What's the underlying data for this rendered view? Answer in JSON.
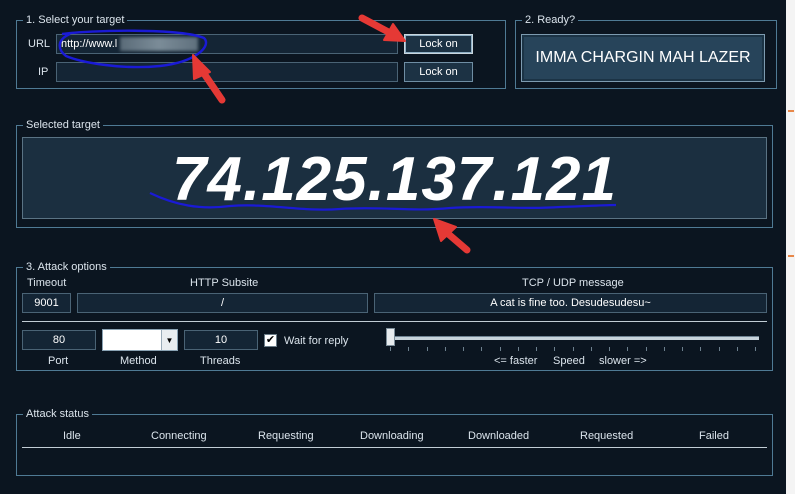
{
  "target": {
    "legend": "1. Select your target",
    "url_label": "URL",
    "url_value": "http://www.l",
    "ip_label": "IP",
    "ip_value": "",
    "lock_on_label": "Lock on",
    "lock_on_ip_label": "Lock on"
  },
  "ready": {
    "legend": "2. Ready?",
    "button_label": "IMMA CHARGIN MAH LAZER"
  },
  "selected": {
    "legend": "Selected target",
    "ip": "74.125.137.121"
  },
  "attack_options": {
    "legend": "3. Attack options",
    "timeout_label": "Timeout",
    "timeout_value": "9001",
    "http_subsite_label": "HTTP Subsite",
    "http_subsite_value": "/",
    "message_label": "TCP / UDP message",
    "message_value": "A cat is fine too. Desudesudesu~",
    "port_value": "80",
    "port_label": "Port",
    "method_value": "",
    "method_label": "Method",
    "threads_value": "10",
    "threads_label": "Threads",
    "wait_reply_label": "Wait for reply",
    "wait_reply_checked": true,
    "speed_faster": "<= faster",
    "speed_label": "Speed",
    "speed_slower": "slower =>",
    "speed_level": 0
  },
  "attack_status": {
    "legend": "Attack status",
    "columns": [
      "Idle",
      "Connecting",
      "Requesting",
      "Downloading",
      "Downloaded",
      "Requested",
      "Failed"
    ]
  },
  "colors": {
    "background": "#0b1520",
    "annotation_red": "#e53935",
    "annotation_blue": "#1a1ad6"
  }
}
